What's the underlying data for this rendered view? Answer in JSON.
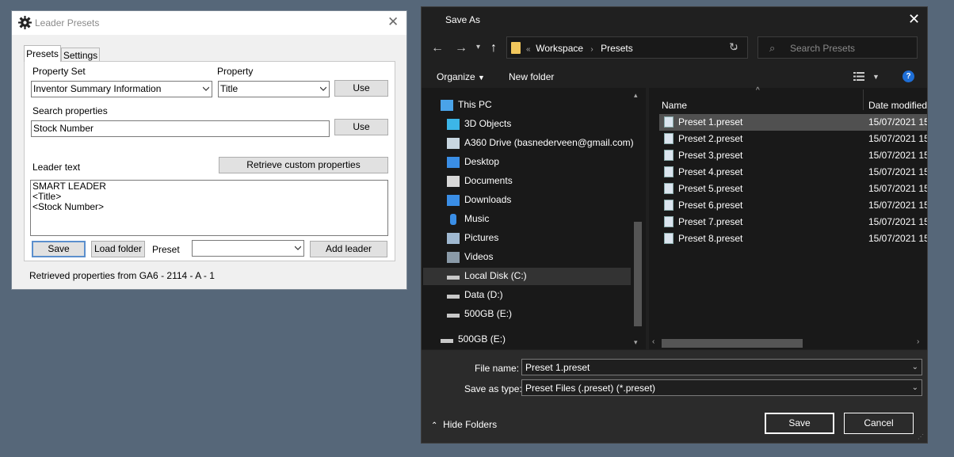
{
  "leader_presets": {
    "title": "Leader Presets",
    "tabs": [
      "Presets",
      "Settings"
    ],
    "property_set_label": "Property Set",
    "property_set_value": "Inventor Summary Information",
    "property_label": "Property",
    "property_value": "Title",
    "use_label": "Use",
    "search_label": "Search properties",
    "search_value": "Stock Number",
    "leader_text_label": "Leader text",
    "retrieve_label": "Retrieve custom properties",
    "leader_text": "SMART LEADER\n<Title>\n<Stock Number>",
    "save_label": "Save",
    "load_folder_label": "Load folder",
    "preset_label": "Preset",
    "preset_value": "",
    "add_leader_label": "Add leader",
    "status": "Retrieved properties from GA6 - 2114 - A - 1"
  },
  "save_as": {
    "title": "Save As",
    "breadcrumb_prefix": "«",
    "breadcrumb": [
      "Workspace",
      "Presets"
    ],
    "search_placeholder": "Search Presets",
    "organize_label": "Organize",
    "new_folder_label": "New folder",
    "help": "?",
    "nav_items": [
      {
        "label": "This PC",
        "icon": "computer-icon"
      },
      {
        "label": "3D Objects",
        "icon": "cube-icon"
      },
      {
        "label": "A360 Drive (basnederveen@gmail.com)",
        "icon": "cloud-drive-icon"
      },
      {
        "label": "Desktop",
        "icon": "desktop-icon"
      },
      {
        "label": "Documents",
        "icon": "documents-icon"
      },
      {
        "label": "Downloads",
        "icon": "download-icon"
      },
      {
        "label": "Music",
        "icon": "music-icon"
      },
      {
        "label": "Pictures",
        "icon": "pictures-icon"
      },
      {
        "label": "Videos",
        "icon": "video-icon"
      },
      {
        "label": "Local Disk (C:)",
        "icon": "drive-icon"
      },
      {
        "label": "Data (D:)",
        "icon": "drive-icon"
      },
      {
        "label": "500GB (E:)",
        "icon": "drive-icon"
      },
      {
        "label": "500GB (E:)",
        "icon": "drive-icon"
      }
    ],
    "columns": {
      "name": "Name",
      "date": "Date modified"
    },
    "files": [
      {
        "name": "Preset 1.preset",
        "date": "15/07/2021 15"
      },
      {
        "name": "Preset 2.preset",
        "date": "15/07/2021 15"
      },
      {
        "name": "Preset 3.preset",
        "date": "15/07/2021 15"
      },
      {
        "name": "Preset 4.preset",
        "date": "15/07/2021 15"
      },
      {
        "name": "Preset 5.preset",
        "date": "15/07/2021 15"
      },
      {
        "name": "Preset 6.preset",
        "date": "15/07/2021 15"
      },
      {
        "name": "Preset 7.preset",
        "date": "15/07/2021 15"
      },
      {
        "name": "Preset 8.preset",
        "date": "15/07/2021 15"
      }
    ],
    "file_name_label": "File name:",
    "file_name_value": "Preset 1.preset",
    "save_type_label": "Save as type:",
    "save_type_value": "Preset Files (.preset) (*.preset)",
    "save_label": "Save",
    "cancel_label": "Cancel",
    "hide_folders_label": "Hide Folders"
  },
  "colors": {
    "desktop": "#566779",
    "dark_bg": "#202020",
    "accent": "#5b8fcd"
  }
}
